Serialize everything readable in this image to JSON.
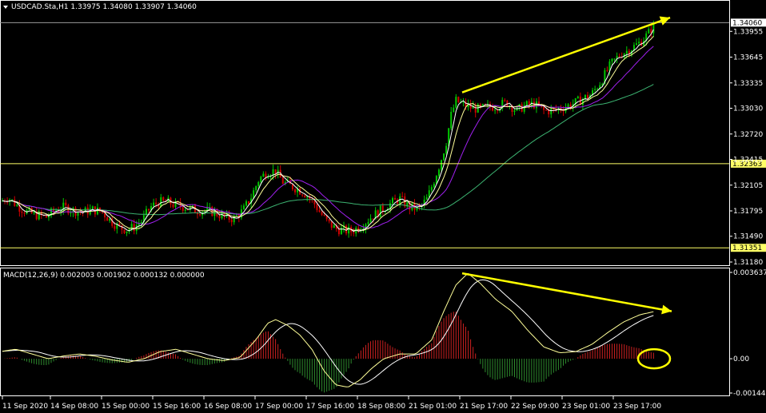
{
  "header": {
    "main_title": "USDCAD.Sta,H1  1.33975 1.34080 1.33907 1.34060",
    "macd_title": "MACD(12,26,9) 0.002003 0.001902 0.000132 0.000000"
  },
  "colors": {
    "background": "#000000",
    "frame": "#ffffff",
    "bull_candle": "#00c800",
    "bear_candle": "#d00000",
    "ma_fast": "#ffffff",
    "ma_mid": "#ffff99",
    "ma_slow": "#a020f0",
    "ma_long": "#3cb371",
    "level_line": "#ffff66",
    "annotation": "#ffff00",
    "hist_pos": "#cc2020",
    "hist_neg": "#2e8b2e"
  },
  "chart_data": [
    {
      "type": "candlestick",
      "symbol": "USDCAD.Sta",
      "timeframe": "H1",
      "last_price": "1.34060",
      "price_axis_ticks": [
        "1.33955",
        "1.33645",
        "1.33335",
        "1.33030",
        "1.32720",
        "1.32415",
        "1.32105",
        "1.31795",
        "1.31490",
        "1.31180"
      ],
      "ylim": [
        1.3118,
        1.3414
      ],
      "levels": [
        {
          "label": "1.34060",
          "value": 1.3406
        },
        {
          "label": "1.32363",
          "value": 1.32363
        },
        {
          "label": "1.31351",
          "value": 1.31351
        }
      ],
      "close_path": [
        [
          0,
          1.319
        ],
        [
          10,
          1.3196
        ],
        [
          20,
          1.3187
        ],
        [
          30,
          1.318
        ],
        [
          40,
          1.3176
        ],
        [
          48,
          1.3174
        ],
        [
          58,
          1.3172
        ],
        [
          68,
          1.318
        ],
        [
          80,
          1.3184
        ],
        [
          92,
          1.318
        ],
        [
          104,
          1.3178
        ],
        [
          116,
          1.3181
        ],
        [
          128,
          1.3178
        ],
        [
          138,
          1.3168
        ],
        [
          148,
          1.316
        ],
        [
          158,
          1.3157
        ],
        [
          168,
          1.316
        ],
        [
          178,
          1.3168
        ],
        [
          188,
          1.3184
        ],
        [
          198,
          1.319
        ],
        [
          210,
          1.319
        ],
        [
          220,
          1.3186
        ],
        [
          232,
          1.3184
        ],
        [
          244,
          1.318
        ],
        [
          256,
          1.318
        ],
        [
          268,
          1.3178
        ],
        [
          280,
          1.3172
        ],
        [
          292,
          1.317
        ],
        [
          304,
          1.318
        ],
        [
          314,
          1.3196
        ],
        [
          324,
          1.3218
        ],
        [
          334,
          1.3226
        ],
        [
          344,
          1.3228
        ],
        [
          354,
          1.3214
        ],
        [
          362,
          1.321
        ],
        [
          372,
          1.3206
        ],
        [
          382,
          1.32
        ],
        [
          392,
          1.319
        ],
        [
          400,
          1.3178
        ],
        [
          410,
          1.3165
        ],
        [
          420,
          1.3158
        ],
        [
          430,
          1.3156
        ],
        [
          440,
          1.3155
        ],
        [
          452,
          1.3162
        ],
        [
          464,
          1.3172
        ],
        [
          476,
          1.318
        ],
        [
          488,
          1.3188
        ],
        [
          500,
          1.3194
        ],
        [
          512,
          1.3184
        ],
        [
          524,
          1.3182
        ],
        [
          534,
          1.3194
        ],
        [
          542,
          1.3214
        ],
        [
          550,
          1.3236
        ],
        [
          558,
          1.3262
        ],
        [
          564,
          1.3294
        ],
        [
          570,
          1.3312
        ],
        [
          578,
          1.3308
        ],
        [
          588,
          1.3304
        ],
        [
          598,
          1.3302
        ],
        [
          610,
          1.3304
        ],
        [
          622,
          1.3306
        ],
        [
          634,
          1.331
        ],
        [
          646,
          1.33
        ],
        [
          656,
          1.3306
        ],
        [
          668,
          1.3308
        ],
        [
          680,
          1.33
        ],
        [
          692,
          1.33
        ],
        [
          704,
          1.3304
        ],
        [
          716,
          1.3308
        ],
        [
          728,
          1.3314
        ],
        [
          740,
          1.332
        ],
        [
          752,
          1.3336
        ],
        [
          764,
          1.3356
        ],
        [
          776,
          1.3368
        ],
        [
          788,
          1.3374
        ],
        [
          800,
          1.3382
        ],
        [
          810,
          1.3392
        ],
        [
          820,
          1.3406
        ]
      ],
      "ma_paths": {
        "ma_fast_offset": 0.0,
        "ma_mid_offset": -0.0004,
        "ma_slow_lag": 18,
        "ma_long_lag": 60
      },
      "trendline": {
        "from": [
          578,
          1.3322
        ],
        "to": [
          838,
          1.3412
        ]
      },
      "x_tick_labels": [
        "11 Sep 2020",
        "14 Sep 08:00",
        "15 Sep 00:00",
        "15 Sep 16:00",
        "16 Sep 08:00",
        "17 Sep 00:00",
        "17 Sep 16:00",
        "18 Sep 08:00",
        "21 Sep 01:00",
        "21 Sep 17:00",
        "22 Sep 09:00",
        "23 Sep 01:00",
        "23 Sep 17:00"
      ]
    },
    {
      "type": "macd",
      "params": "12,26,9",
      "values": {
        "macd": 0.002003,
        "signal": 0.001902,
        "histogram": 0.000132,
        "extra": 0.0
      },
      "axis_ticks": [
        "0.003637",
        "0.00",
        "-0.001445"
      ],
      "ylim": [
        -0.001445,
        0.003637
      ],
      "macd_path": [
        [
          0,
          0.0003
        ],
        [
          20,
          0.0004
        ],
        [
          40,
          0.0002
        ],
        [
          60,
          0.0
        ],
        [
          80,
          0.00012
        ],
        [
          100,
          0.0002
        ],
        [
          120,
          0.0001
        ],
        [
          140,
          -5e-05
        ],
        [
          160,
          -0.00015
        ],
        [
          180,
          0.0
        ],
        [
          200,
          0.0003
        ],
        [
          220,
          0.0004
        ],
        [
          240,
          0.0002
        ],
        [
          260,
          0.0
        ],
        [
          280,
          -8e-05
        ],
        [
          300,
          5e-05
        ],
        [
          320,
          0.0008
        ],
        [
          335,
          0.0015
        ],
        [
          345,
          0.00165
        ],
        [
          360,
          0.0014
        ],
        [
          375,
          0.001
        ],
        [
          390,
          0.0004
        ],
        [
          405,
          -0.0005
        ],
        [
          420,
          -0.0011
        ],
        [
          435,
          -0.0012
        ],
        [
          450,
          -0.0009
        ],
        [
          465,
          -0.0004
        ],
        [
          480,
          0.0
        ],
        [
          500,
          0.0002
        ],
        [
          520,
          0.0002
        ],
        [
          540,
          0.0008
        ],
        [
          555,
          0.002
        ],
        [
          570,
          0.0031
        ],
        [
          585,
          0.0036
        ],
        [
          600,
          0.0032
        ],
        [
          620,
          0.0025
        ],
        [
          640,
          0.002
        ],
        [
          660,
          0.0012
        ],
        [
          680,
          0.0005
        ],
        [
          700,
          0.00025
        ],
        [
          720,
          0.0003
        ],
        [
          740,
          0.0006
        ],
        [
          760,
          0.0011
        ],
        [
          780,
          0.00155
        ],
        [
          800,
          0.00185
        ],
        [
          820,
          0.002
        ]
      ],
      "signal_lag": 12,
      "trendline": {
        "from": [
          578,
          0.0036
        ],
        "to": [
          840,
          0.002
        ]
      },
      "highlight": {
        "center": [
          818,
          0.0
        ]
      }
    }
  ]
}
